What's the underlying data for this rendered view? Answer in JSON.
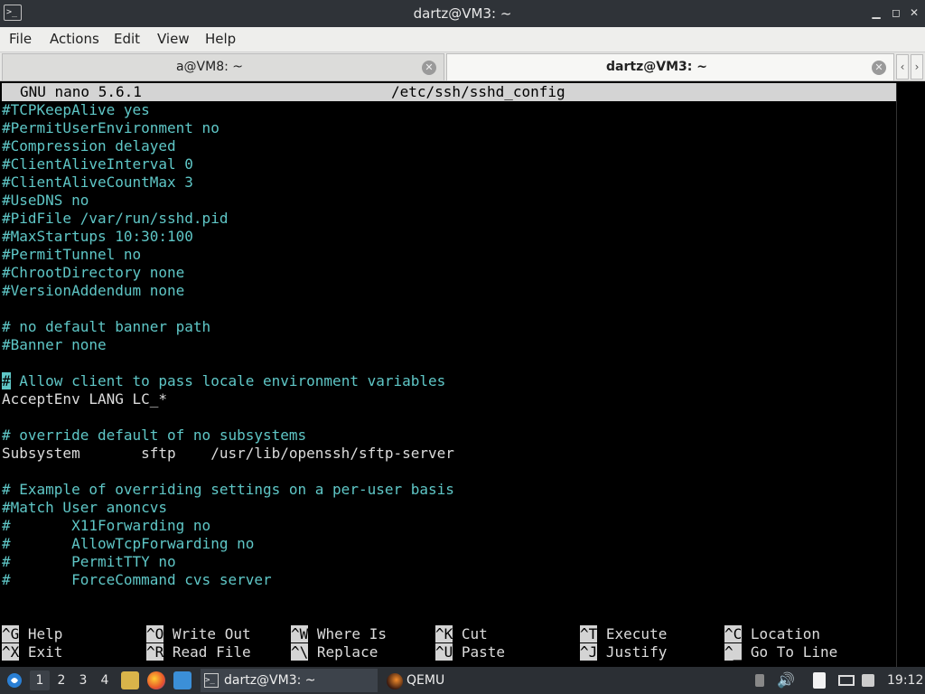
{
  "window": {
    "title": "dartz@VM3: ~",
    "controls": {
      "minimize": "▁",
      "maximize": "◻",
      "close": "✕"
    }
  },
  "menu": [
    "File",
    "Actions",
    "Edit",
    "View",
    "Help"
  ],
  "tabs": [
    {
      "label": "a@VM8: ~",
      "active": false
    },
    {
      "label": "dartz@VM3: ~",
      "active": true
    }
  ],
  "nano": {
    "version": "GNU nano 5.6.1",
    "file": "/etc/ssh/sshd_config",
    "lines": [
      "#TCPKeepAlive yes",
      "#PermitUserEnvironment no",
      "#Compression delayed",
      "#ClientAliveInterval 0",
      "#ClientAliveCountMax 3",
      "#UseDNS no",
      "#PidFile /var/run/sshd.pid",
      "#MaxStartups 10:30:100",
      "#PermitTunnel no",
      "#ChrootDirectory none",
      "#VersionAddendum none",
      "",
      "# no default banner path",
      "#Banner none",
      "",
      "# Allow client to pass locale environment variables",
      "AcceptEnv LANG LC_*",
      "",
      "# override default of no subsystems",
      "Subsystem       sftp    /usr/lib/openssh/sftp-server",
      "",
      "# Example of overriding settings on a per-user basis",
      "#Match User anoncvs",
      "#       X11Forwarding no",
      "#       AllowTcpForwarding no",
      "#       PermitTTY no",
      "#       ForceCommand cvs server"
    ],
    "line_colors": [
      "c",
      "c",
      "c",
      "c",
      "c",
      "c",
      "c",
      "c",
      "c",
      "c",
      "c",
      "",
      "c",
      "c",
      "",
      "c",
      "w",
      "",
      "c",
      "w",
      "",
      "c",
      "c",
      "c",
      "c",
      "c",
      "c"
    ],
    "shortcuts_row1": [
      {
        "key": "^G",
        "label": " Help"
      },
      {
        "key": "^O",
        "label": " Write Out"
      },
      {
        "key": "^W",
        "label": " Where Is"
      },
      {
        "key": "^K",
        "label": " Cut"
      },
      {
        "key": "^T",
        "label": " Execute"
      },
      {
        "key": "^C",
        "label": " Location"
      }
    ],
    "shortcuts_row2": [
      {
        "key": "^X",
        "label": " Exit"
      },
      {
        "key": "^R",
        "label": " Read File"
      },
      {
        "key": "^\\",
        "label": " Replace"
      },
      {
        "key": "^U",
        "label": " Paste"
      },
      {
        "key": "^J",
        "label": " Justify"
      },
      {
        "key": "^_",
        "label": " Go To Line"
      }
    ]
  },
  "panel": {
    "workspaces": [
      "1",
      "2",
      "3",
      "4"
    ],
    "tasks": [
      {
        "label": "dartz@VM3: ~",
        "icon": "terminal-icon"
      },
      {
        "label": "QEMU",
        "icon": "qemu-icon"
      }
    ],
    "clock": "19:12"
  },
  "colors": {
    "comment": "#5fc7c7",
    "text": "#dcdcdc",
    "panel": "#2b2f34"
  }
}
